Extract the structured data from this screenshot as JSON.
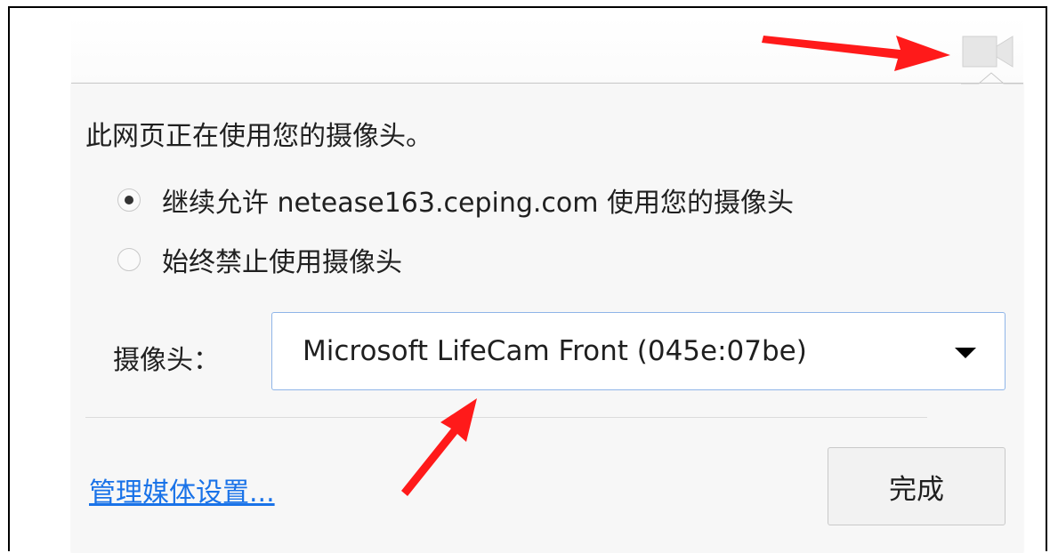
{
  "popup": {
    "title": "此网页正在使用您的摄像头。",
    "options": [
      {
        "label": "继续允许 netease163.ceping.com 使用您的摄像头",
        "selected": true
      },
      {
        "label": "始终禁止使用摄像头",
        "selected": false
      }
    ],
    "camera_label": "摄像头：",
    "camera_select": {
      "value": "Microsoft LifeCam Front (045e:07be)"
    },
    "manage_link": "管理媒体设置...",
    "done_button": "完成"
  },
  "toolbar": {
    "icon": "camera-icon"
  },
  "colors": {
    "link": "#1a73e8",
    "select_border": "#8fb5e8",
    "annotation_arrow": "#ff1a1a",
    "popup_background": "#f7f7f7"
  }
}
